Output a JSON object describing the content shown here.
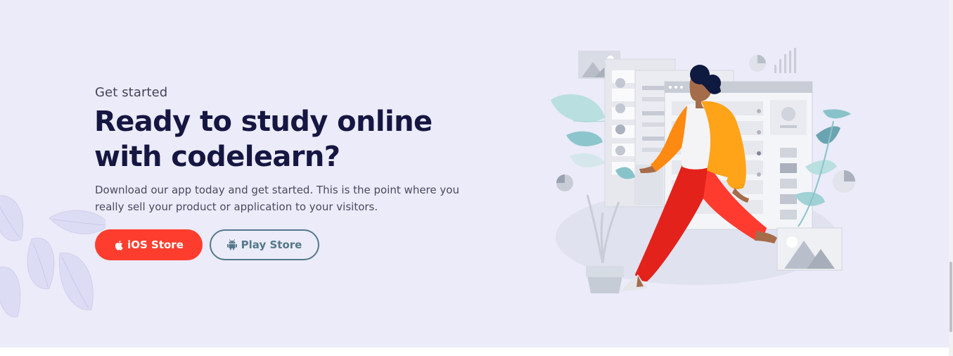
{
  "hero": {
    "eyebrow": "Get started",
    "headline": "Ready to study online with codelearn?",
    "description": "Download our app today and get started. This is the point where you really sell your product or application to your visitors.",
    "ios_button": {
      "label": "iOS Store",
      "icon": "apple-icon"
    },
    "play_button": {
      "label": "Play Store",
      "icon": "android-icon"
    }
  },
  "colors": {
    "background": "#ebebf9",
    "headline": "#161642",
    "ios_button": "#ff3d2e",
    "play_button": "#54788a"
  },
  "illustration": {
    "subject": "person-walking-with-dashboard"
  }
}
